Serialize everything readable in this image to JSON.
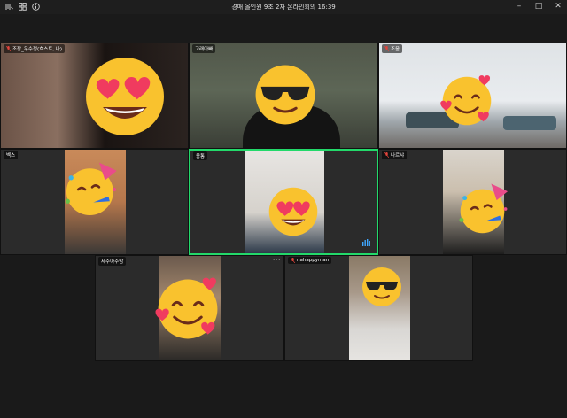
{
  "window": {
    "title": "경매 올인원 9조 2차 온라인회의 16:39"
  },
  "participants": [
    {
      "name": "조장_우수정(호스트, 나)",
      "muted": true,
      "emoji": "heart-eyes"
    },
    {
      "name": "고래아빠",
      "muted": false,
      "emoji": "sunglasses"
    },
    {
      "name": "조음",
      "muted": true,
      "emoji": "smiling-hearts"
    },
    {
      "name": "벡스",
      "muted": false,
      "emoji": "party"
    },
    {
      "name": "응통",
      "muted": false,
      "emoji": "heart-eyes"
    },
    {
      "name": "나르샤",
      "muted": true,
      "emoji": "party"
    },
    {
      "name": "제주아주맘",
      "muted": false,
      "emoji": "smiling-hearts"
    },
    {
      "name": "nahappyman",
      "muted": true,
      "emoji": "sunglasses"
    }
  ],
  "more_label": "···",
  "colors": {
    "active_speaker": "#23d96a",
    "muted_mic": "#e0443c"
  }
}
